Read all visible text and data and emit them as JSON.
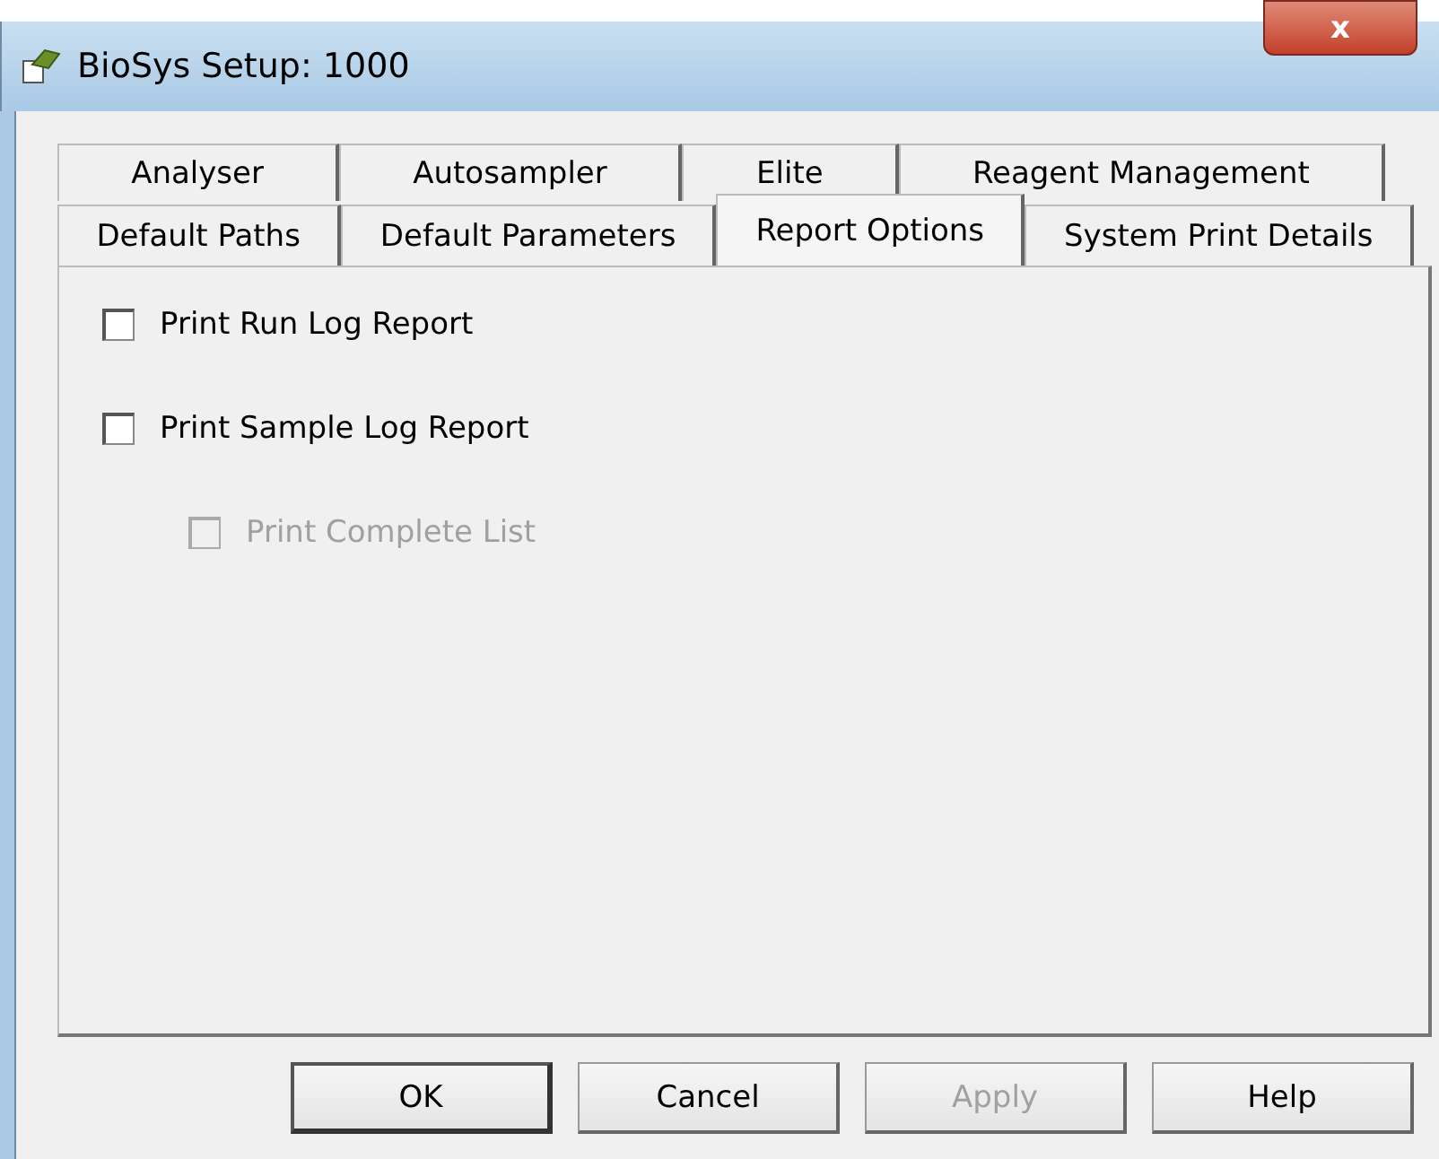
{
  "window": {
    "title": "BioSys Setup: 1000",
    "close_label": "x"
  },
  "tab_rows": [
    [
      {
        "label": "Analyser",
        "selected": false
      },
      {
        "label": "Autosampler",
        "selected": false
      },
      {
        "label": "Elite",
        "selected": false
      },
      {
        "label": "Reagent Management",
        "selected": false
      }
    ],
    [
      {
        "label": "Default Paths",
        "selected": false
      },
      {
        "label": "Default Parameters",
        "selected": false
      },
      {
        "label": "Report Options",
        "selected": true
      },
      {
        "label": "System Print Details",
        "selected": false
      }
    ]
  ],
  "options": [
    {
      "label": "Print Run Log Report",
      "checked": false,
      "disabled": false
    },
    {
      "label": "Print Sample Log Report",
      "checked": false,
      "disabled": false,
      "children": [
        {
          "label": "Print Complete List",
          "checked": false,
          "disabled": true
        }
      ]
    }
  ],
  "buttons": [
    {
      "label": "OK",
      "default": true,
      "disabled": false
    },
    {
      "label": "Cancel",
      "default": false,
      "disabled": false
    },
    {
      "label": "Apply",
      "default": false,
      "disabled": true
    },
    {
      "label": "Help",
      "default": false,
      "disabled": false
    }
  ]
}
